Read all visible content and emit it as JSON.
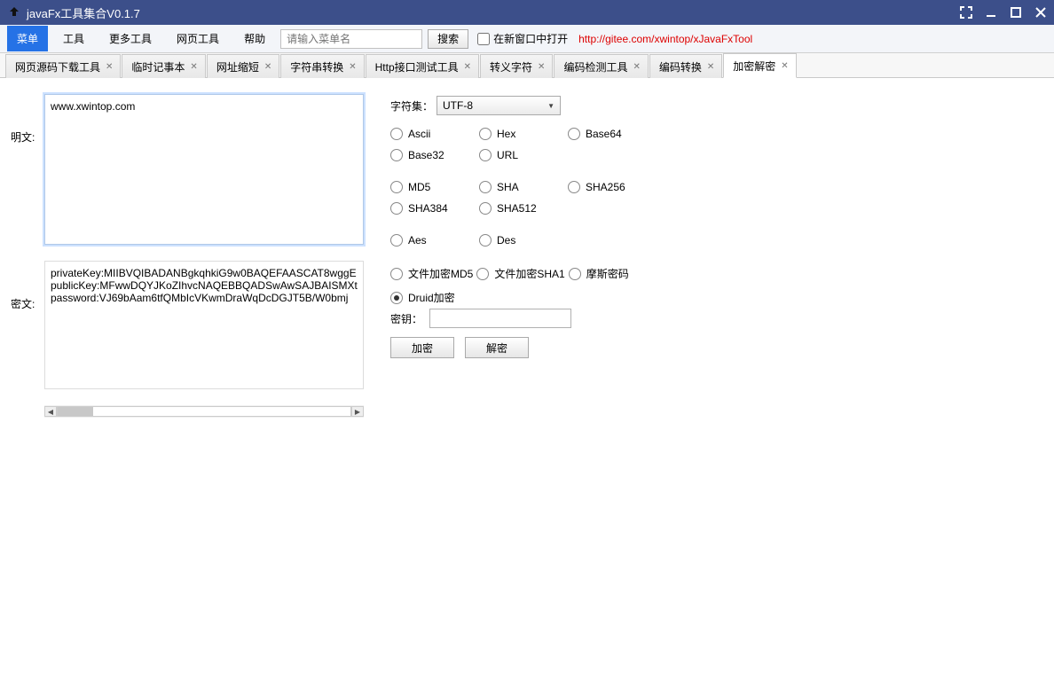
{
  "window": {
    "title": "javaFx工具集合V0.1.7"
  },
  "menubar": {
    "items": [
      "菜单",
      "工具",
      "更多工具",
      "网页工具",
      "帮助"
    ],
    "search_placeholder": "请输入菜单名",
    "search_btn": "搜索",
    "open_new_window": "在新窗口中打开",
    "link": "http://gitee.com/xwintop/xJavaFxTool"
  },
  "tabs": [
    {
      "label": "网页源码下载工具"
    },
    {
      "label": "临时记事本"
    },
    {
      "label": "网址缩短"
    },
    {
      "label": "字符串转换"
    },
    {
      "label": "Http接口测试工具"
    },
    {
      "label": "转义字符"
    },
    {
      "label": "编码检测工具"
    },
    {
      "label": "编码转换"
    },
    {
      "label": "加密解密"
    }
  ],
  "panel": {
    "plain_label": "明文:",
    "plain_text": "www.xwintop.com",
    "cipher_label": "密文:",
    "cipher_text": "privateKey:MIIBVQIBADANBgkqhkiG9w0BAQEFAASCAT8wggE\npublicKey:MFwwDQYJKoZIhvcNAQEBBQADSwAwSAJBAISMXt\npassword:VJ69bAam6tfQMbIcVKwmDraWqDcDGJT5B/W0bmj",
    "charset_label": "字符集：",
    "charset_value": "UTF-8",
    "group1": [
      "Ascii",
      "Hex",
      "Base64",
      "Base32",
      "URL"
    ],
    "group2": [
      "MD5",
      "SHA",
      "SHA256",
      "SHA384",
      "SHA512"
    ],
    "group3": [
      "Aes",
      "Des"
    ],
    "group4": [
      "文件加密MD5",
      "文件加密SHA1",
      "摩斯密码",
      "Druid加密"
    ],
    "selected": "Druid加密",
    "key_label": "密钥：",
    "encrypt_btn": "加密",
    "decrypt_btn": "解密"
  }
}
